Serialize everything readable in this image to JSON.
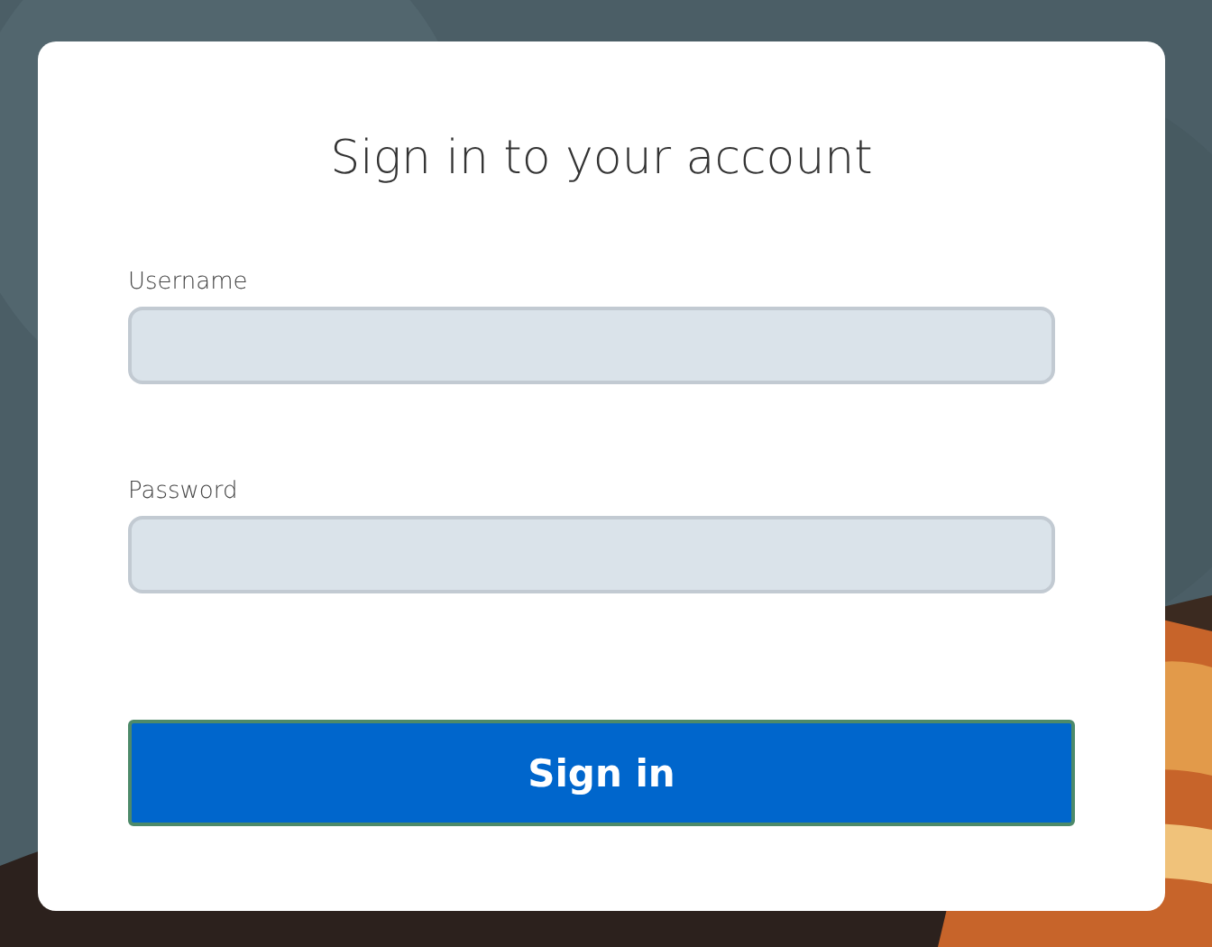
{
  "title": "Sign in to your account",
  "fields": [
    {
      "label": "Username"
    },
    {
      "label": "Password"
    }
  ],
  "submit": "Sign in"
}
